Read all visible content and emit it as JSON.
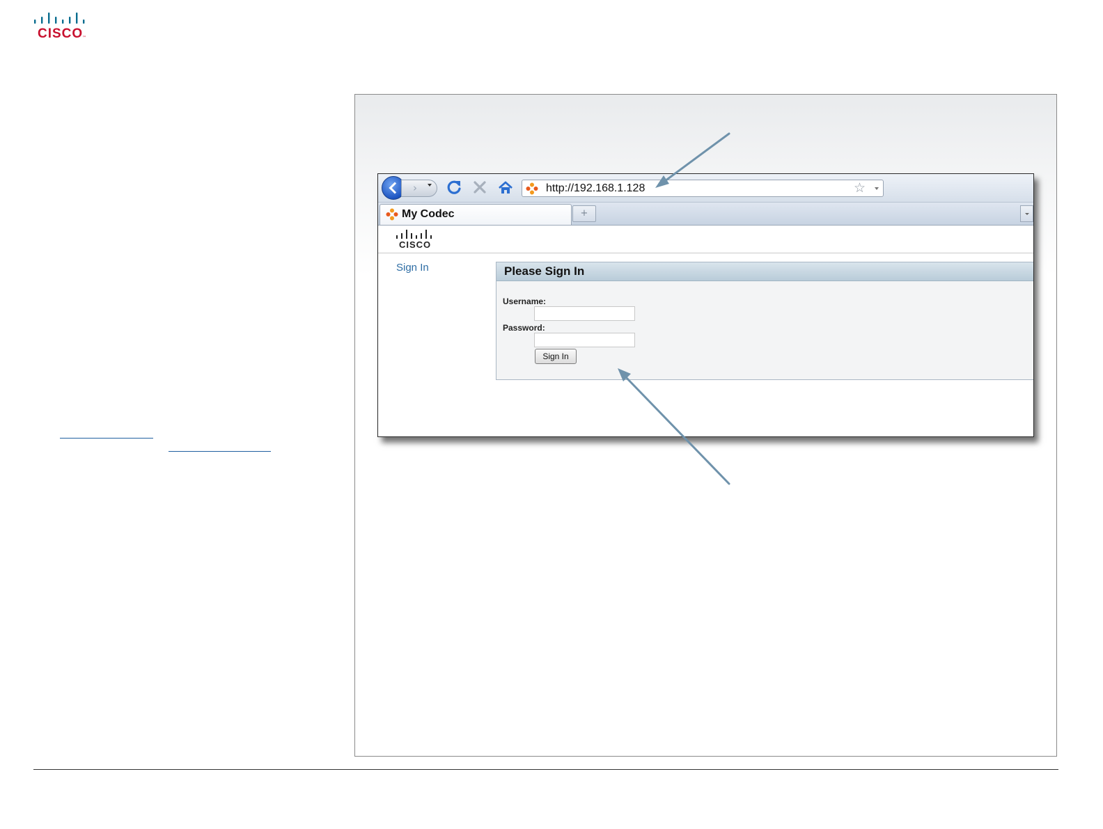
{
  "document": {
    "brand_logo": {
      "wordmark": "CISCO",
      "trademark": "™"
    },
    "colors": {
      "brand_red": "#c8102e",
      "link_blue": "#2e6da4",
      "arrow": "#6f92ab"
    }
  },
  "browser": {
    "address_bar": {
      "url": "http://192.168.1.128"
    },
    "tabs": [
      {
        "label": "My Codec"
      }
    ],
    "toolbar_icons": [
      "back-icon",
      "forward-icon",
      "reload-icon",
      "stop-icon",
      "home-icon",
      "bookmark-star-icon"
    ]
  },
  "web_page": {
    "logo_wordmark": "CISCO",
    "nav": {
      "sign_in_link": "Sign In"
    },
    "panel": {
      "title": "Please Sign In",
      "username_label": "Username:",
      "username_value": "",
      "password_label": "Password:",
      "password_value": "",
      "submit_label": "Sign In"
    }
  }
}
